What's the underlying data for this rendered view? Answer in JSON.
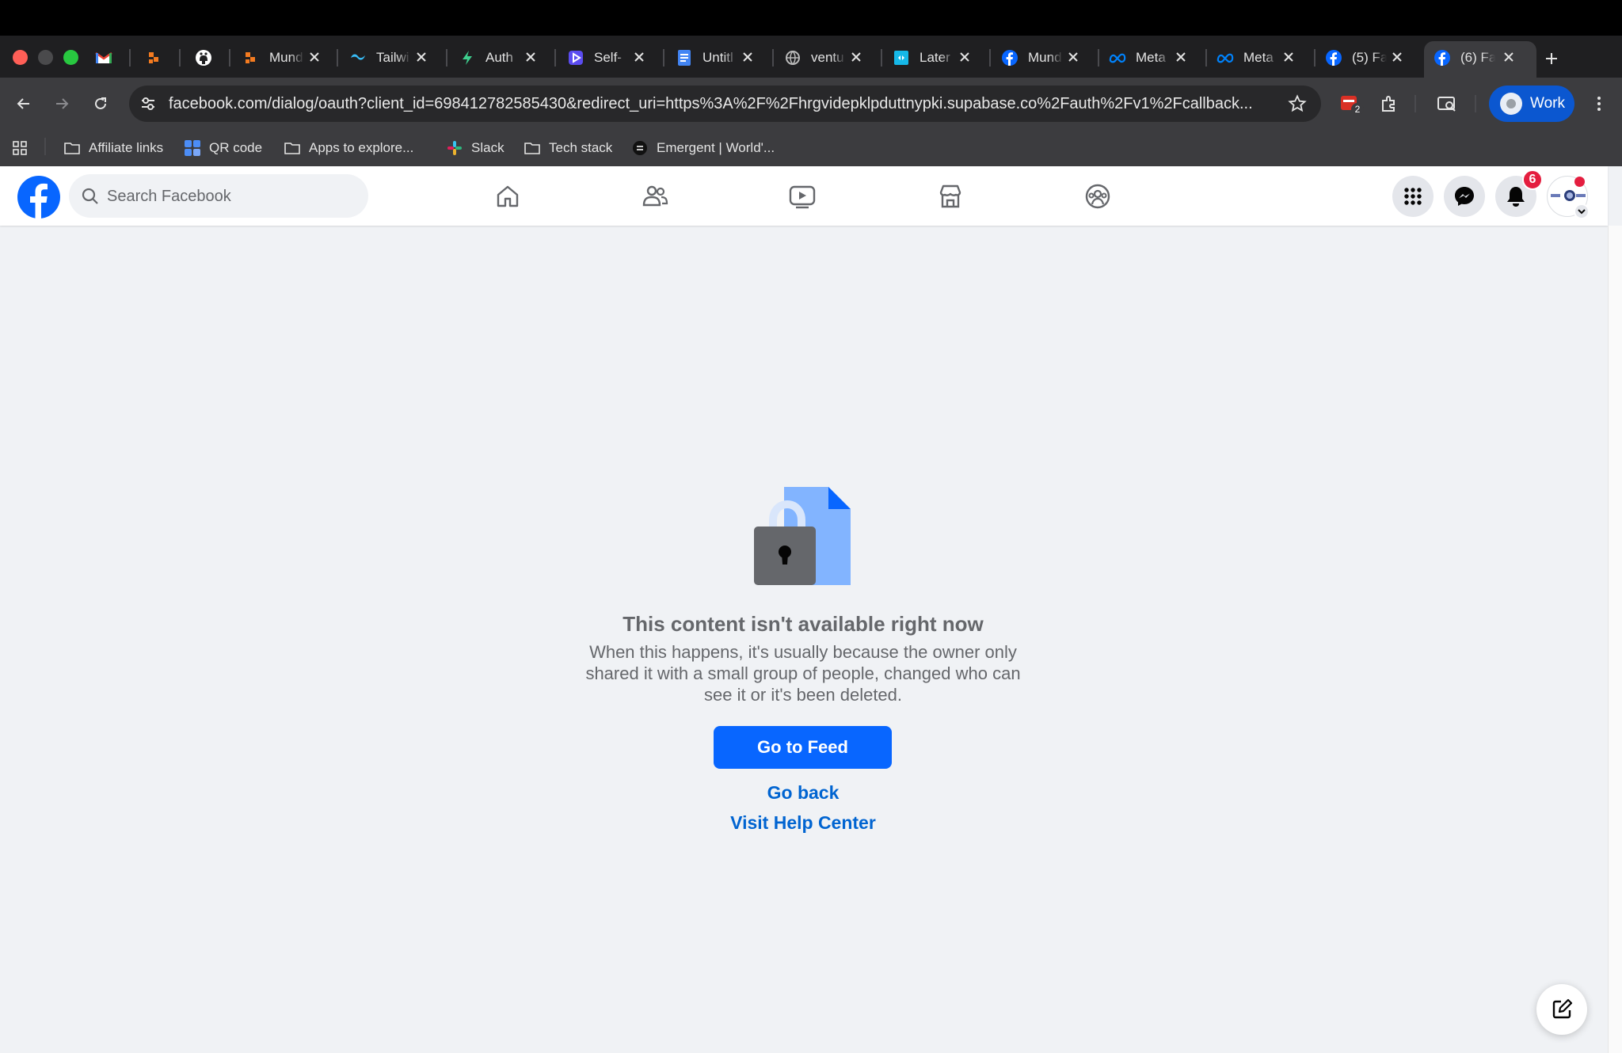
{
  "browser": {
    "tabs": [
      {
        "title": "",
        "icon": "gmail-icon"
      },
      {
        "title": "",
        "icon": "orange-blocks-icon"
      },
      {
        "title": "",
        "icon": "github-icon"
      },
      {
        "title": "Mund",
        "icon": "orange-blocks-icon"
      },
      {
        "title": "Tailwi",
        "icon": "tailwind-icon"
      },
      {
        "title": "Auth",
        "icon": "bolt-icon"
      },
      {
        "title": "Self-",
        "icon": "play-icon"
      },
      {
        "title": "Untitl",
        "icon": "docs-icon"
      },
      {
        "title": "ventu",
        "icon": "globe-icon"
      },
      {
        "title": "Later",
        "icon": "later-icon"
      },
      {
        "title": "Mund",
        "icon": "facebook-icon"
      },
      {
        "title": "Meta",
        "icon": "meta-icon"
      },
      {
        "title": "Meta",
        "icon": "meta-icon"
      },
      {
        "title": "(5) Fa",
        "icon": "facebook-icon"
      },
      {
        "title": "(6) Fa",
        "icon": "facebook-icon",
        "active": true
      }
    ],
    "url": "facebook.com/dialog/oauth?client_id=698412782585430&redirect_uri=https%3A%2F%2Fhrgvidepklpduttnypki.supabase.co%2Fauth%2Fv1%2Fcallback...",
    "extension_badge": "2",
    "profile_label": "Work",
    "bookmarks": [
      {
        "label": "Affiliate links",
        "icon": "folder-icon"
      },
      {
        "label": "QR code",
        "icon": "qr-app-icon"
      },
      {
        "label": "Apps to explore...",
        "icon": "folder-icon"
      },
      {
        "label": "Slack",
        "icon": "slack-icon"
      },
      {
        "label": "Tech stack",
        "icon": "folder-icon"
      },
      {
        "label": "Emergent | World'...",
        "icon": "emergent-icon"
      }
    ]
  },
  "facebook": {
    "search_placeholder": "Search Facebook",
    "notification_count": "6",
    "error": {
      "title": "This content isn't available right now",
      "body_lines": [
        "When this happens, it's usually because the owner only",
        "shared it with a small group of people, changed who can",
        "see it or it's been deleted."
      ]
    },
    "go_to_feed_label": "Go to Feed",
    "go_back_label": "Go back",
    "help_center_label": "Visit Help Center"
  },
  "colors": {
    "facebook_blue": "#0866ff",
    "link_blue": "#0064d1",
    "text_secondary": "#65676b",
    "badge_red": "#e41e3f",
    "page_bg": "#f0f2f5"
  }
}
